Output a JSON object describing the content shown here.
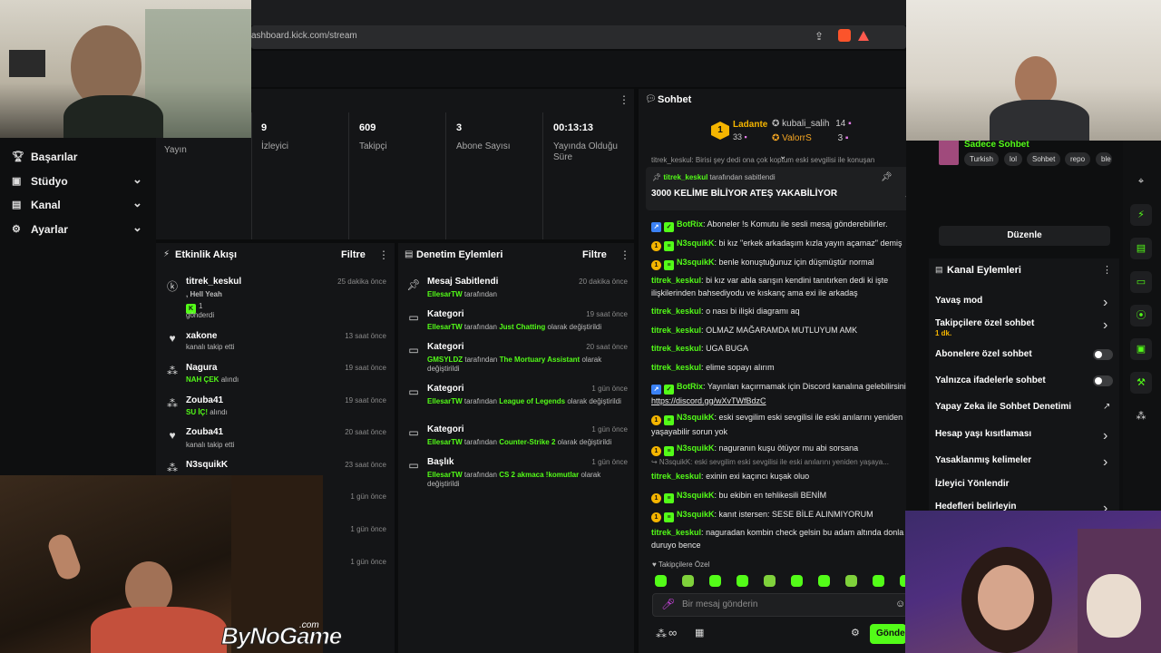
{
  "browser": {
    "url": "ashboard.kick.com/stream"
  },
  "watermark": {
    "brand": "ByNoGame",
    "suffix": ".com"
  },
  "sidebar": {
    "items": [
      {
        "label": "Başarılar",
        "expandable": false
      },
      {
        "label": "Stüdyo",
        "expandable": true
      },
      {
        "label": "Kanal",
        "expandable": true
      },
      {
        "label": "Ayarlar",
        "expandable": true
      }
    ]
  },
  "stats": {
    "first_label": "Yayın",
    "items": [
      {
        "value": "9",
        "label": "İzleyici"
      },
      {
        "value": "609",
        "label": "Takipçi"
      },
      {
        "value": "3",
        "label": "Abone Sayısı"
      },
      {
        "value": "00:13:13",
        "label": "Yayında Olduğu Süre"
      }
    ]
  },
  "activity": {
    "title": "Etkinlik Akışı",
    "filter": "Filtre",
    "events": [
      {
        "icon": "kick-icon",
        "name": "titrek_keskul",
        "line1": ", Hell Yeah",
        "line2": "1",
        "line3": "gönderdi",
        "time": "25 dakika önce"
      },
      {
        "icon": "heart-icon",
        "name": "xakone",
        "line1": "kanalı takip etti",
        "time": "13 saat önce"
      },
      {
        "icon": "reward-icon",
        "name": "Nagura",
        "hl": "NAH ÇEK",
        "line1": "alındı",
        "time": "19 saat önce"
      },
      {
        "icon": "reward-icon",
        "name": "Zouba41",
        "hl": "SU İÇ!",
        "line1": "alındı",
        "time": "19 saat önce"
      },
      {
        "icon": "heart-icon",
        "name": "Zouba41",
        "line1": "kanalı takip etti",
        "time": "20 saat önce"
      },
      {
        "icon": "reward-icon",
        "name": "N3squikK",
        "line1": "",
        "time": "23 saat önce"
      }
    ],
    "extra_times": [
      "1 gün önce",
      "1 gün önce",
      "1 gün önce"
    ]
  },
  "moderation": {
    "title": "Denetim Eylemleri",
    "filter": "Filtre",
    "items": [
      {
        "icon": "pin-icon",
        "title": "Mesaj Sabitlendi",
        "actor": "EllesarTW",
        "text": "tarafından",
        "target": "",
        "tail": "",
        "time": "20 dakika önce"
      },
      {
        "icon": "category-icon",
        "title": "Kategori",
        "actor": "EllesarTW",
        "text": "tarafından",
        "target": "Just Chatting",
        "tail": "olarak değiştirildi",
        "time": "19 saat önce"
      },
      {
        "icon": "category-icon",
        "title": "Kategori",
        "actor": "GMSYLDZ",
        "text": "tarafından",
        "target": "The Mortuary Assistant",
        "tail": "olarak değiştirildi",
        "time": "20 saat önce"
      },
      {
        "icon": "category-icon",
        "title": "Kategori",
        "actor": "EllesarTW",
        "text": "tarafından",
        "target": "League of Legends",
        "tail": "olarak değiştirildi",
        "time": "1 gün önce"
      },
      {
        "icon": "category-icon",
        "title": "Kategori",
        "actor": "EllesarTW",
        "text": "tarafından",
        "target": "Counter-Strike 2",
        "tail": "olarak değiştirildi",
        "time": "1 gün önce"
      },
      {
        "icon": "title-icon",
        "title": "Başlık",
        "actor": "EllesarTW",
        "text": "tarafından",
        "target": "CS 2 akmaca !komutlar",
        "tail": "olarak değiştirildi",
        "time": "1 gün önce"
      }
    ]
  },
  "chat": {
    "title": "Sohbet",
    "leaderboard": {
      "first": {
        "rank": "1",
        "name": "Ladante",
        "count": "33"
      },
      "others": [
        {
          "name": "kubali_salih",
          "count": "14"
        },
        {
          "name": "ValorrS",
          "count": "3"
        }
      ]
    },
    "cut_line": "titrek_keskul: Birisi şey dedi ona çok koptum eski sevgilisi ile konuşan",
    "pinned": {
      "by_user": "titrek_keskul",
      "by_text": "tarafından sabitlendi",
      "text": "3000 KELİME BİLİYOR ATEŞ YAKABİLİYOR"
    },
    "messages": [
      {
        "badges": [
          "bot",
          "verified"
        ],
        "user": "BotRix",
        "text": "Aboneler !s Komutu ile sesli mesaj gönderebilirler."
      },
      {
        "badges": [
          "gold",
          "sub"
        ],
        "user": "N3squikK",
        "text": "bi kız \"erkek arkadaşım kızla yayın açamaz\" demiş"
      },
      {
        "badges": [
          "gold",
          "sub"
        ],
        "user": "N3squikK",
        "text": "benle konuştuğunuz için düşmüştür normal"
      },
      {
        "badges": [],
        "user": "titrek_keskul",
        "text": "bi kız var abla sarışın kendini tanıtırken dedi ki işte ilişkilerinden bahsediyodu ve kıskanç ama exi ile arkadaş"
      },
      {
        "badges": [],
        "user": "titrek_keskul",
        "text": "o nası bi ilişki diagramı aq"
      },
      {
        "badges": [],
        "user": "titrek_keskul",
        "text": "OLMAZ MAĞARAMDA MUTLUYUM AMK"
      },
      {
        "badges": [],
        "user": "titrek_keskul",
        "text": "UGA BUGA"
      },
      {
        "badges": [],
        "user": "titrek_keskul",
        "text": "elime sopayı alırım"
      },
      {
        "badges": [
          "bot",
          "verified"
        ],
        "user": "BotRix",
        "text": "Yayınları kaçırmamak için Discord kanalına gelebilirsiniz:",
        "link": "https://discord.gg/wXvTWfBdzC"
      },
      {
        "badges": [
          "gold",
          "sub"
        ],
        "user": "N3squikK",
        "text": "eski sevgilim eski sevgilisi ile eski anılarını yeniden yaşayabilir sorun yok"
      },
      {
        "badges": [
          "gold",
          "sub"
        ],
        "user": "N3squikK",
        "text": "naguranın kuşu ötüyor mu abi sorsana"
      },
      {
        "reply": "↪ N3squikK: eski sevgilim eski sevgilisi ile eski anılarını yeniden yaşaya...",
        "badges": [],
        "user": "titrek_keskul",
        "text": "exinin exi kaçıncı kuşak oluo"
      },
      {
        "badges": [
          "gold",
          "sub"
        ],
        "user": "N3squikK",
        "text": "bu ekibin en tehlikesili BENİM"
      },
      {
        "badges": [
          "gold",
          "sub"
        ],
        "user": "N3squikK",
        "text": "kanıt istersen: SESE BİLE ALINMIYORUM"
      },
      {
        "badges": [],
        "user": "titrek_keskul",
        "text": "naguradan kombin check gelsin bu adam altında donla duruyo bence"
      }
    ],
    "emote_label": "Takipçilere Özel",
    "input_placeholder": "Bir mesaj gönderin",
    "send_label": "Gönder"
  },
  "right": {
    "channel_title": "Sadece Sohbet",
    "tags": [
      "Turkish",
      "lol",
      "Sohbet",
      "repo",
      "ble"
    ],
    "edit_label": "Düzenle",
    "actions_title": "Kanal Eylemleri",
    "actions": [
      {
        "label": "Yavaş mod",
        "control": "chevron"
      },
      {
        "label": "Takipçilere özel sohbet",
        "sub": "1 dk.",
        "control": "chevron"
      },
      {
        "label": "Abonelere özel sohbet",
        "control": "toggle",
        "on": false
      },
      {
        "label": "Yalnızca ifadelerle sohbet",
        "control": "toggle",
        "on": false
      },
      {
        "label": "Yapay Zeka ile Sohbet Denetimi",
        "control": "external"
      },
      {
        "label": "Hesap yaşı kısıtlaması",
        "control": "chevron"
      },
      {
        "label": "Yasaklanmış kelimeler",
        "control": "chevron"
      },
      {
        "label": "İzleyici Yönlendir",
        "control": "none"
      },
      {
        "label": "Hedefleri belirleyin",
        "control": "chevron"
      }
    ]
  },
  "colors": {
    "accent": "#53fc18",
    "bg": "#0b0c0d",
    "panel": "#141517",
    "gold": "#f5b500"
  }
}
